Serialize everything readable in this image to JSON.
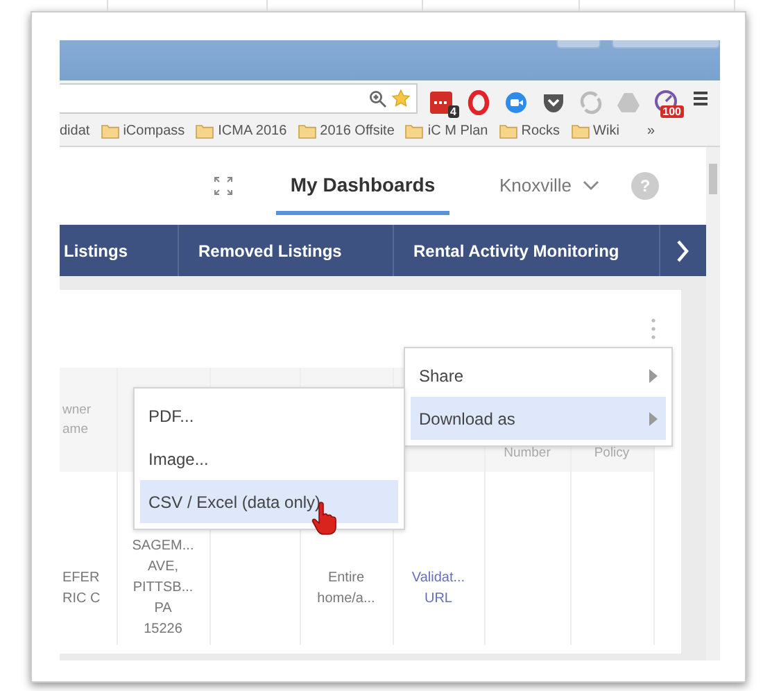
{
  "browser": {
    "extensions": [
      {
        "kind": "lastpass",
        "badge": "4"
      },
      {
        "kind": "opera"
      },
      {
        "kind": "camera"
      },
      {
        "kind": "pocket"
      },
      {
        "kind": "sync"
      },
      {
        "kind": "drive"
      },
      {
        "kind": "gauge",
        "badge": "100"
      }
    ],
    "bookmarks": [
      {
        "label": "didat",
        "folder": false
      },
      {
        "label": "iCompass",
        "folder": true
      },
      {
        "label": "ICMA 2016",
        "folder": true
      },
      {
        "label": "2016 Offsite",
        "folder": true
      },
      {
        "label": "iC M Plan",
        "folder": true
      },
      {
        "label": "Rocks",
        "folder": true
      },
      {
        "label": "Wiki",
        "folder": true
      }
    ],
    "bookmarks_more": "»"
  },
  "header": {
    "tabs": [
      {
        "label": "My Dashboards",
        "selected": true
      }
    ],
    "location": "Knoxville",
    "help": "?"
  },
  "nav": {
    "items": [
      {
        "label": "Listings"
      },
      {
        "label": "Removed Listings"
      },
      {
        "label": "Rental Activity Monitoring"
      }
    ]
  },
  "table": {
    "columns": [
      {
        "label": "wner\name"
      },
      null,
      null,
      null,
      null,
      {
        "label": "Number"
      },
      {
        "label": "Policy"
      }
    ],
    "rows": [
      [
        {
          "kind": "text",
          "text": "EFER\nRIC C"
        },
        {
          "kind": "text",
          "text": "SAGEM...\nAVE,\nPITTSB...\nPA\n15226"
        },
        {
          "kind": "empty"
        },
        {
          "kind": "text",
          "text": "Entire\nhome/a..."
        },
        {
          "kind": "link",
          "text": "Validat...\nURL"
        },
        {
          "kind": "empty"
        },
        {
          "kind": "empty"
        }
      ]
    ]
  },
  "menu": {
    "items": [
      {
        "label": "Share",
        "selected": false
      },
      {
        "label": "Download as",
        "selected": true
      }
    ]
  },
  "submenu": {
    "items": [
      {
        "label": "PDF...",
        "selected": false
      },
      {
        "label": "Image...",
        "selected": false
      },
      {
        "label": "CSV / Excel (data only)",
        "selected": true
      }
    ]
  }
}
